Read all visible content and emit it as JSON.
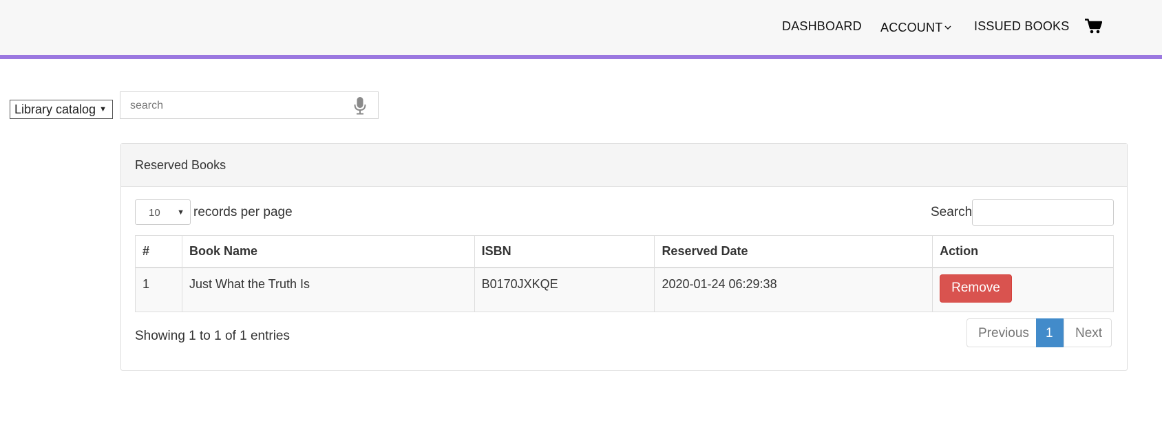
{
  "nav": {
    "items": [
      {
        "label": "DASHBOARD"
      },
      {
        "label": "ACCOUNT"
      },
      {
        "label": "ISSUED BOOKS"
      }
    ],
    "cart_icon": "shopping-cart-icon",
    "accent_color": "#9b78e0"
  },
  "catalog": {
    "selected": "Library catalog",
    "search_placeholder": "search",
    "search_value": ""
  },
  "panel": {
    "title": "Reserved Books",
    "length_value": "10",
    "length_label": "records per page",
    "filter_label": "Search:",
    "filter_value": "",
    "columns": [
      "#",
      "Book Name",
      "ISBN",
      "Reserved Date",
      "Action"
    ],
    "rows": [
      {
        "num": "1",
        "book_name": "Just What the Truth Is",
        "isbn": "B0170JXKQE",
        "reserved_date": "2020-01-24 06:29:38",
        "action": "Remove"
      }
    ],
    "info": "Showing 1 to 1 of 1 entries",
    "pagination": {
      "previous": "Previous",
      "current": "1",
      "next": "Next"
    }
  },
  "colors": {
    "remove_button": "#d9534f",
    "active_page": "#428bca"
  }
}
